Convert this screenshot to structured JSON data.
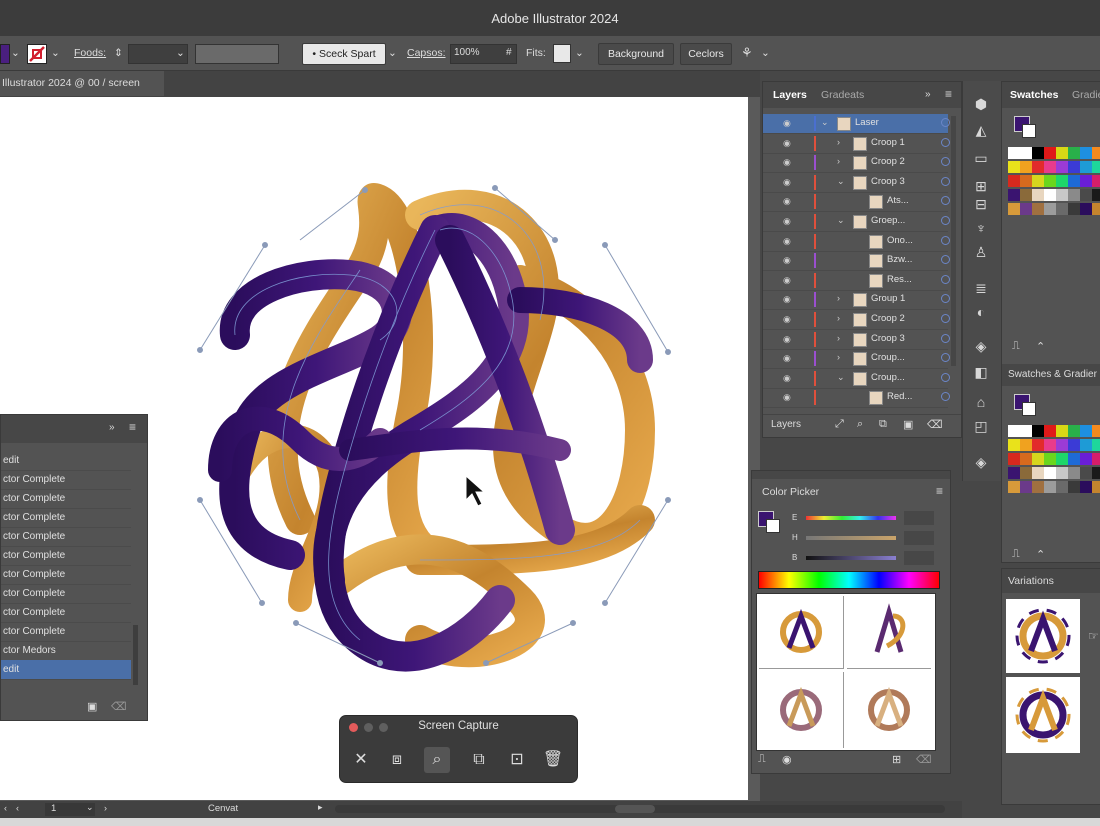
{
  "window": {
    "title": "Adobe Illustrator 2024"
  },
  "controlbar": {
    "fonds_label": "Foods:",
    "brush_label": "Sceck Spart",
    "opacity_label": "Capsos:",
    "opacity_value": "100%",
    "hash_label": "#",
    "fits_label": "Fits:",
    "background_button": "Background",
    "colors_button": "Ceclors"
  },
  "document": {
    "tab_label": "Illustrator 2024 @ 00 / screen"
  },
  "layers_panel": {
    "tabs": [
      "Layers",
      "Gradeats"
    ],
    "footer_label": "Layers",
    "rows": [
      {
        "name": "Laser",
        "indent": 0,
        "bar": "#4a6fd0",
        "chevron": "⌄",
        "selected": true
      },
      {
        "name": "Croop 1",
        "indent": 1,
        "bar": "#e0503c",
        "chevron": "›"
      },
      {
        "name": "Croop 2",
        "indent": 1,
        "bar": "#9b4fd0",
        "chevron": "›"
      },
      {
        "name": "Croop 3",
        "indent": 1,
        "bar": "#e0503c",
        "chevron": "⌄"
      },
      {
        "name": "Ats...",
        "indent": 2,
        "bar": "#e0503c",
        "chevron": ""
      },
      {
        "name": "Groep...",
        "indent": 1,
        "bar": "#e0503c",
        "chevron": "⌄"
      },
      {
        "name": "Ono...",
        "indent": 2,
        "bar": "#e0503c",
        "chevron": ""
      },
      {
        "name": "Bzw...",
        "indent": 2,
        "bar": "#9b4fd0",
        "chevron": ""
      },
      {
        "name": "Res...",
        "indent": 2,
        "bar": "#e0503c",
        "chevron": ""
      },
      {
        "name": "Group 1",
        "indent": 1,
        "bar": "#9b4fd0",
        "chevron": "›"
      },
      {
        "name": "Croop 2",
        "indent": 1,
        "bar": "#e0503c",
        "chevron": "›"
      },
      {
        "name": "Croop 3",
        "indent": 1,
        "bar": "#e0503c",
        "chevron": "›"
      },
      {
        "name": "Croup...",
        "indent": 1,
        "bar": "#9b4fd0",
        "chevron": "›"
      },
      {
        "name": "Croup...",
        "indent": 1,
        "bar": "#e0503c",
        "chevron": "⌄"
      },
      {
        "name": "Red...",
        "indent": 2,
        "bar": "#e0503c",
        "chevron": ""
      }
    ]
  },
  "history_panel": {
    "rows": [
      "edit",
      "ctor Complete",
      "ctor Complete",
      "ctor Complete",
      "ctor Complete",
      "ctor Complete",
      "ctor Complete",
      "ctor Complete",
      "ctor Complete",
      "ctor Complete",
      "ctor Medors",
      "edit"
    ]
  },
  "color_picker": {
    "title": "Color Picker",
    "labels": [
      "E",
      "H",
      "B"
    ]
  },
  "swatches_panel": {
    "tab": "Swatches",
    "tab2": "Gradie",
    "section2": "Swatches & Gradier"
  },
  "variations_panel": {
    "title": "Variations"
  },
  "screen_capture": {
    "title": "Screen Capture"
  },
  "statusbar": {
    "zoom": "1",
    "tool": "Cenvat"
  },
  "colors": {
    "purple": "#3a1470",
    "gold": "#d79a3a",
    "panel": "#535353",
    "selection": "#4a6fa8"
  }
}
